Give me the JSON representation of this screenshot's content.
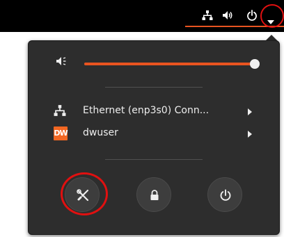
{
  "topbar": {
    "tray_icons": [
      "network-wired-icon",
      "volume-icon",
      "power-icon",
      "dropdown-arrow-icon"
    ],
    "accent_color": "#e95420"
  },
  "system_menu": {
    "volume": {
      "icon": "speaker-icon",
      "level": 1.0
    },
    "items": [
      {
        "icon": "network-wired-icon",
        "label": "Ethernet (enp3s0) Conn...",
        "has_submenu": true
      },
      {
        "icon": "dw-logo",
        "logo_text": "DW",
        "label": "dwuser",
        "has_submenu": true
      }
    ],
    "actions": [
      {
        "name": "settings",
        "icon": "settings-tools-icon"
      },
      {
        "name": "lock",
        "icon": "lock-icon"
      },
      {
        "name": "power-off",
        "icon": "power-icon"
      }
    ]
  },
  "annotations": {
    "highlight_color": "#e01010",
    "highlighted": [
      "dropdown-arrow-icon",
      "settings-button"
    ]
  }
}
